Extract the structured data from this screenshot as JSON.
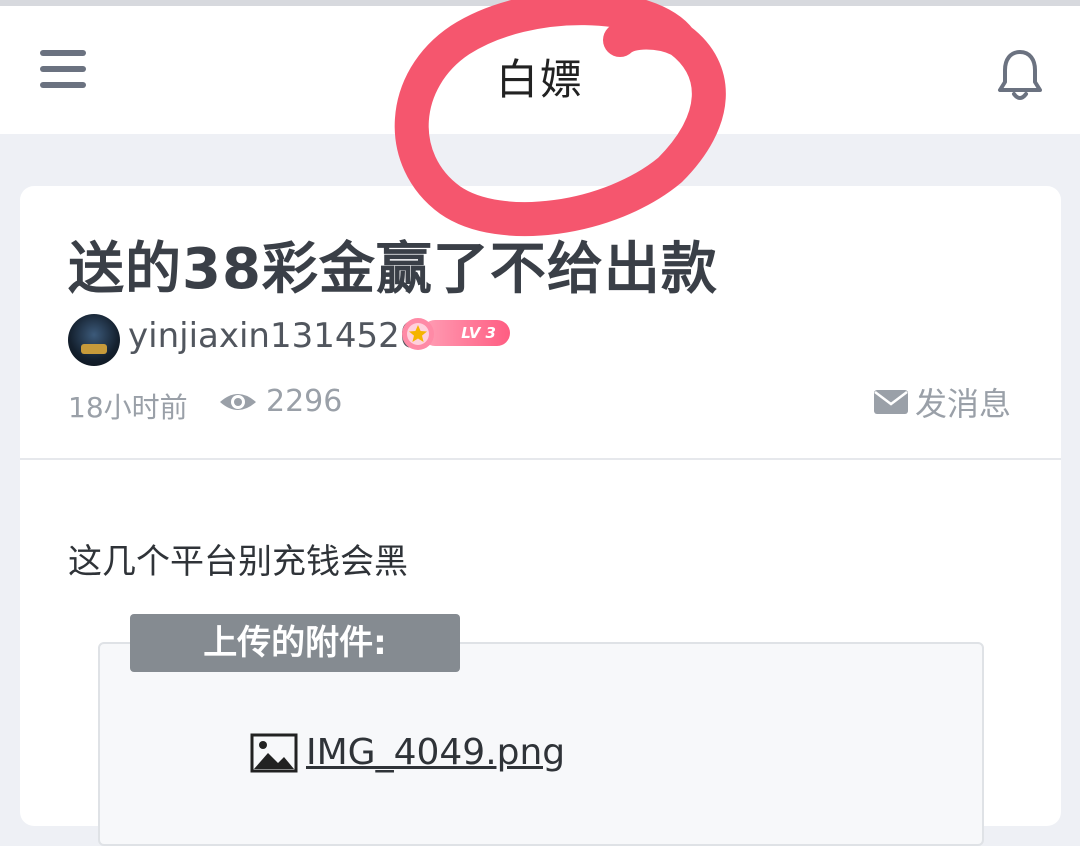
{
  "header": {
    "title": "白嫖",
    "menu_icon": "menu-icon",
    "bell_icon": "bell-icon"
  },
  "post": {
    "title": "送的38彩金赢了不给出款",
    "author": "yinjiaxin1314520",
    "level": "LV 3",
    "time": "18小时前",
    "views": "2296",
    "message_label": "发消息",
    "body": "这几个平台别充钱会黑"
  },
  "attachments": {
    "header": "上传的附件:",
    "files": [
      "IMG_4049.png"
    ]
  },
  "colors": {
    "accent_pink": "#ff5d82",
    "annotation_red": "#f5566e"
  }
}
